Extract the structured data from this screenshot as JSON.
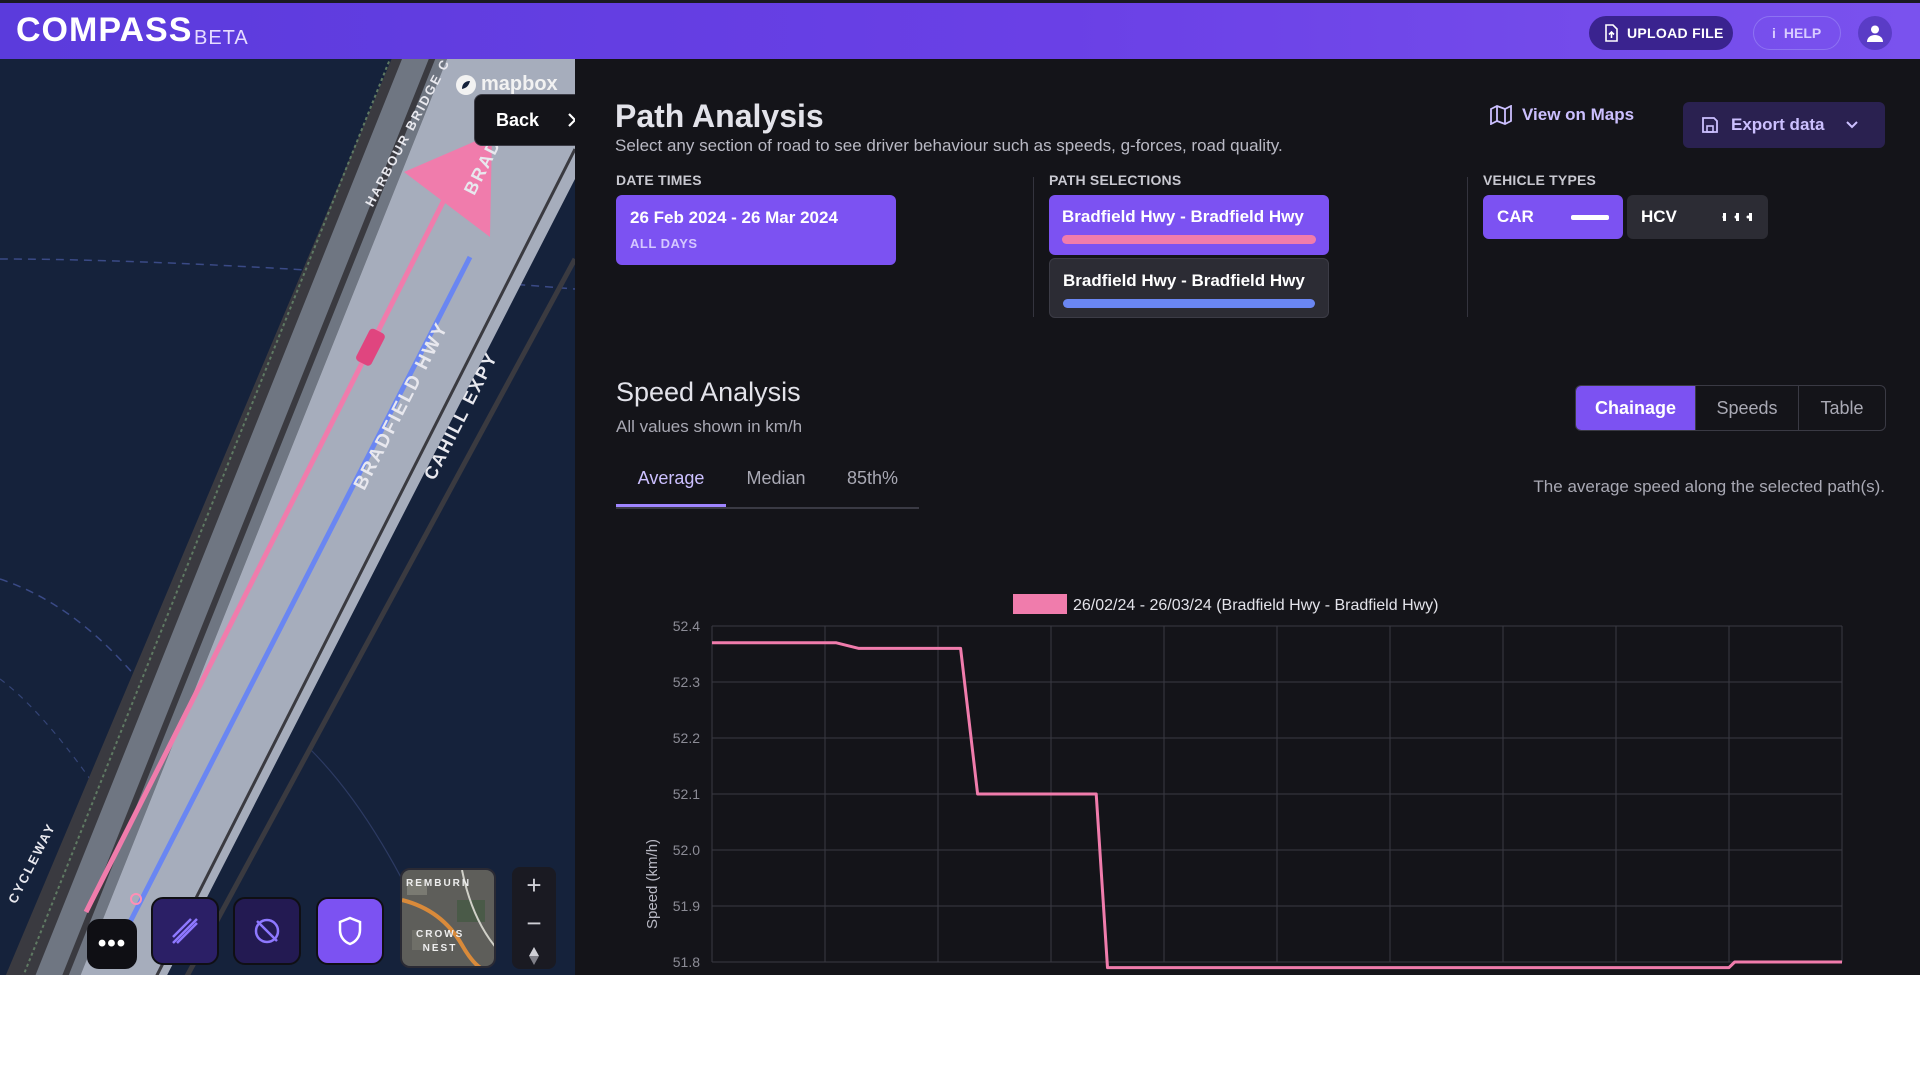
{
  "app": {
    "name": "COMPASS",
    "badge": "BETA"
  },
  "header": {
    "upload_label": "UPLOAD FILE",
    "help_label": "HELP"
  },
  "map": {
    "attribution": "mapbox",
    "back_label": "Back",
    "roads": [
      "HARBOUR BRIDGE CYC",
      "BRADFIELD HWY",
      "CAHILL EXPY",
      "CYCLEWAY",
      "BRAD"
    ],
    "minimap_labels": [
      "REMBURN",
      "CROWS NEST"
    ]
  },
  "page": {
    "title": "Path Analysis",
    "subtitle": "Select any section of road to see driver behaviour such as speeds, g-forces, road quality.",
    "view_maps_label": "View on Maps",
    "export_label": "Export data"
  },
  "filters": {
    "date_times": {
      "label": "DATE TIMES",
      "range": "26 Feb 2024 - 26 Mar 2024",
      "days": "ALL DAYS"
    },
    "path_selections": {
      "label": "PATH SELECTIONS",
      "items": [
        {
          "name": "Bradfield Hwy - Bradfield Hwy",
          "color": "#f07cac",
          "selected": true
        },
        {
          "name": "Bradfield Hwy - Bradfield Hwy",
          "color": "#6a86f2",
          "selected": false
        }
      ]
    },
    "vehicle_types": {
      "label": "VEHICLE TYPES",
      "items": [
        {
          "name": "CAR",
          "selected": true
        },
        {
          "name": "HCV",
          "selected": false
        }
      ]
    }
  },
  "speed": {
    "title": "Speed Analysis",
    "subtitle": "All values shown in km/h",
    "views": [
      "Chainage",
      "Speeds",
      "Table"
    ],
    "active_view": "Chainage",
    "tabs": [
      "Average",
      "Median",
      "85th%"
    ],
    "active_tab": "Average",
    "hint": "The average speed along the selected path(s)."
  },
  "chart_data": {
    "type": "line",
    "legend": [
      "26/02/24 - 26/03/24 (Bradfield Hwy - Bradfield Hwy)"
    ],
    "ylabel": "Speed (km/h)",
    "xlabel": "",
    "ylim": [
      51.8,
      52.4
    ],
    "y_ticks": [
      52.4,
      52.3,
      52.2,
      52.1,
      52.0,
      51.9,
      51.8
    ],
    "x_range": [
      0,
      10
    ],
    "grid": true,
    "series": [
      {
        "color": "#f07cac",
        "points": [
          [
            0.0,
            52.37
          ],
          [
            1.1,
            52.37
          ],
          [
            1.3,
            52.36
          ],
          [
            2.2,
            52.36
          ],
          [
            2.35,
            52.1
          ],
          [
            3.4,
            52.1
          ],
          [
            3.5,
            51.79
          ],
          [
            9.0,
            51.79
          ],
          [
            9.05,
            51.8
          ],
          [
            10.0,
            51.8
          ]
        ]
      }
    ]
  }
}
